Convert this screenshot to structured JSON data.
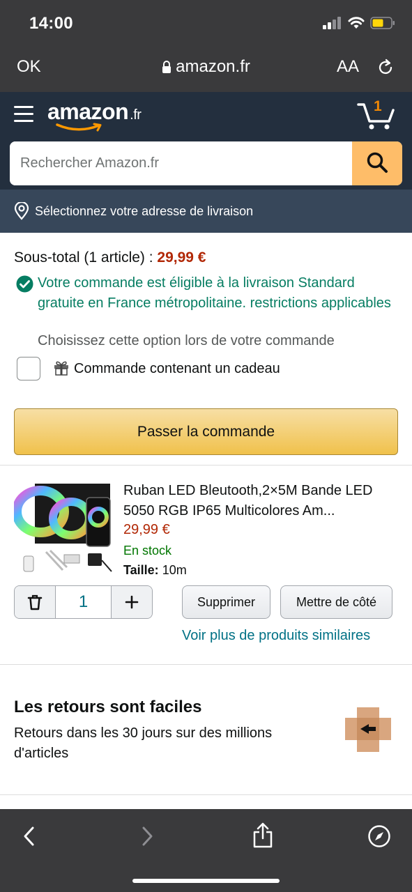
{
  "status": {
    "time": "14:00"
  },
  "browser": {
    "ok_label": "OK",
    "url": "amazon.fr",
    "text_size_label": "AA"
  },
  "header": {
    "logo_text": "amazon",
    "logo_tld": ".fr",
    "cart_count": "1",
    "search_placeholder": "Rechercher Amazon.fr",
    "deliver_text": "Sélectionnez votre adresse de livraison"
  },
  "cart": {
    "subtotal_label": "Sous-total (1 article) : ",
    "subtotal_price": "29,99 €",
    "eligible_text": "Votre commande est éligible à la livraison Standard gratuite en France métropolitaine. restrictions applicables",
    "choose_note": "Choisissez cette option lors de votre commande",
    "gift_label": "Commande contenant un cadeau",
    "checkout_label": "Passer la commande"
  },
  "product": {
    "title": "Ruban LED Bleutooth,2×5M Bande LED 5050 RGB IP65 Multicolores Am...",
    "price": "29,99 €",
    "stock": "En stock",
    "size_label": "Taille:",
    "size_value": "10m",
    "quantity": "1",
    "delete_label": "Supprimer",
    "save_later_label": "Mettre de côté",
    "similar_link": "Voir plus de produits similaires"
  },
  "returns": {
    "title": "Les retours sont faciles",
    "description": "Retours dans les 30 jours sur des millions d'articles"
  },
  "colors": {
    "header_bg": "#232f3e",
    "deliver_bg": "#37475a",
    "search_button": "#febd69",
    "price": "#b12704",
    "link": "#007185",
    "success": "#067d62",
    "stock": "#007600",
    "checkout": "#f0c14b"
  },
  "icons": [
    "signal-icon",
    "wifi-icon",
    "battery-icon",
    "lock-icon",
    "reload-icon",
    "menu-icon",
    "cart-icon",
    "search-icon",
    "location-pin-icon",
    "check-circle-icon",
    "gift-icon",
    "trash-icon",
    "plus-icon",
    "return-box-icon",
    "back-icon",
    "forward-icon",
    "share-icon",
    "compass-icon"
  ]
}
